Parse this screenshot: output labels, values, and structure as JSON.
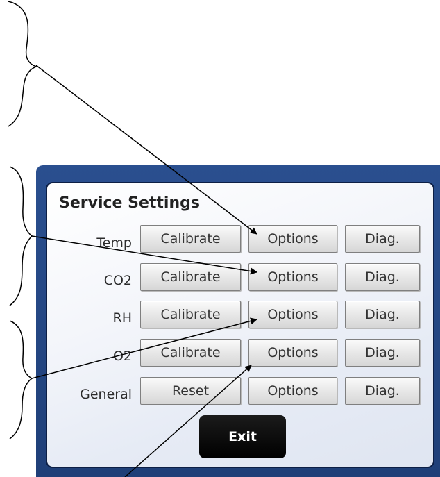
{
  "title": "Service Settings",
  "rows": [
    {
      "label": "Temp",
      "buttons": [
        "Calibrate",
        "Options",
        "Diag."
      ]
    },
    {
      "label": "CO2",
      "buttons": [
        "Calibrate",
        "Options",
        "Diag."
      ]
    },
    {
      "label": "RH",
      "buttons": [
        "Calibrate",
        "Options",
        "Diag."
      ]
    },
    {
      "label": "O2",
      "buttons": [
        "Calibrate",
        "Options",
        "Diag."
      ]
    },
    {
      "label": "General",
      "buttons": [
        "Reset",
        "Options",
        "Diag."
      ]
    }
  ],
  "exit_label": "Exit"
}
